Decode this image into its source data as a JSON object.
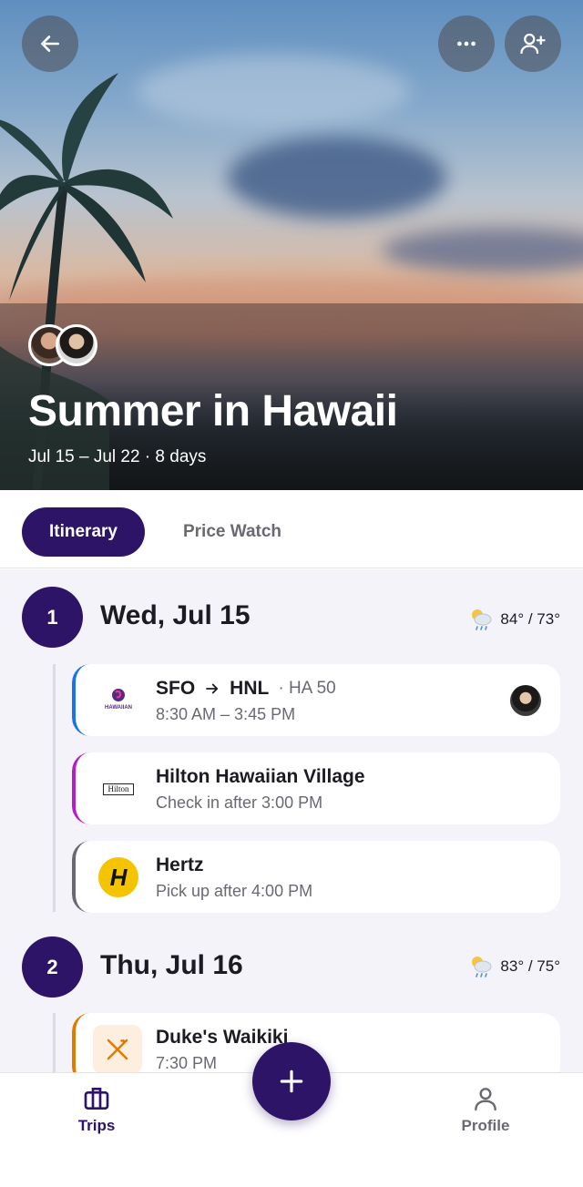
{
  "hero": {
    "title": "Summer in Hawaii",
    "dates": "Jul 15 – Jul 22 · 8 days"
  },
  "tabs": [
    {
      "label": "Itinerary",
      "selected": true
    },
    {
      "label": "Price Watch",
      "selected": false
    }
  ],
  "days": [
    {
      "number": "1",
      "title": "Wed, Jul 15",
      "weather": "84° / 73°",
      "items": [
        {
          "origin": "SFO",
          "destination": "HNL",
          "flight": "· HA 50",
          "line2": "8:30 AM – 3:45 PM",
          "accent": "#1a73e8",
          "logo_text": "HAWAIIAN"
        },
        {
          "line1": "Hilton Hawaiian Village",
          "line2": "Check in after 3:00 PM",
          "accent": "#b31fc4",
          "logo_text": "Hilton"
        },
        {
          "line1": "Hertz",
          "line2": "Pick up after 4:00 PM",
          "accent": "#6b6872",
          "logo_text": "H"
        }
      ]
    },
    {
      "number": "2",
      "title": "Thu, Jul 16",
      "weather": "83° / 75°",
      "items": [
        {
          "line1": "Duke's Waikiki",
          "line2": "7:30 PM",
          "accent": "#e07b00"
        }
      ]
    }
  ],
  "nav": {
    "trips": "Trips",
    "profile": "Profile"
  },
  "colors": {
    "primary": "#2d1466",
    "background": "#f4f3fa"
  }
}
